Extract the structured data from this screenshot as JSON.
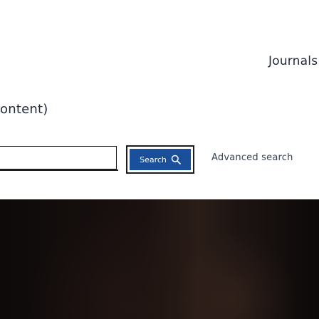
{
  "nav": {
    "journals_label": "Journals"
  },
  "search": {
    "context_text": "ontent)",
    "input_value": "",
    "button_label": "Search",
    "advanced_label": "Advanced search"
  },
  "colors": {
    "search_button": "#1a4f9b",
    "text": "#1f2937",
    "hero_dark": "#0e0a0a"
  }
}
